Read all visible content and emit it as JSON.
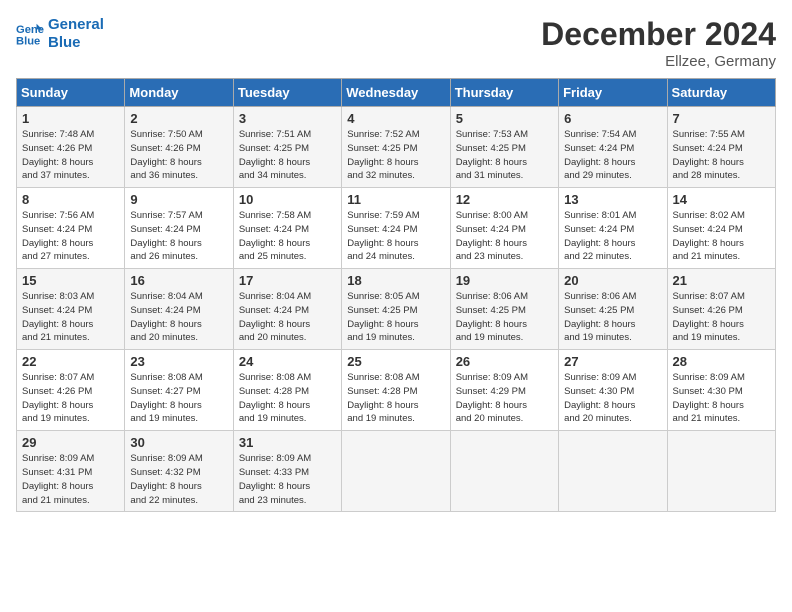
{
  "logo": {
    "line1": "General",
    "line2": "Blue"
  },
  "title": "December 2024",
  "subtitle": "Ellzee, Germany",
  "header_days": [
    "Sunday",
    "Monday",
    "Tuesday",
    "Wednesday",
    "Thursday",
    "Friday",
    "Saturday"
  ],
  "weeks": [
    [
      {
        "day": "1",
        "sunrise": "7:48 AM",
        "sunset": "4:26 PM",
        "daylight": "8 hours and 37 minutes."
      },
      {
        "day": "2",
        "sunrise": "7:50 AM",
        "sunset": "4:26 PM",
        "daylight": "8 hours and 36 minutes."
      },
      {
        "day": "3",
        "sunrise": "7:51 AM",
        "sunset": "4:25 PM",
        "daylight": "8 hours and 34 minutes."
      },
      {
        "day": "4",
        "sunrise": "7:52 AM",
        "sunset": "4:25 PM",
        "daylight": "8 hours and 32 minutes."
      },
      {
        "day": "5",
        "sunrise": "7:53 AM",
        "sunset": "4:25 PM",
        "daylight": "8 hours and 31 minutes."
      },
      {
        "day": "6",
        "sunrise": "7:54 AM",
        "sunset": "4:24 PM",
        "daylight": "8 hours and 29 minutes."
      },
      {
        "day": "7",
        "sunrise": "7:55 AM",
        "sunset": "4:24 PM",
        "daylight": "8 hours and 28 minutes."
      }
    ],
    [
      {
        "day": "8",
        "sunrise": "7:56 AM",
        "sunset": "4:24 PM",
        "daylight": "8 hours and 27 minutes."
      },
      {
        "day": "9",
        "sunrise": "7:57 AM",
        "sunset": "4:24 PM",
        "daylight": "8 hours and 26 minutes."
      },
      {
        "day": "10",
        "sunrise": "7:58 AM",
        "sunset": "4:24 PM",
        "daylight": "8 hours and 25 minutes."
      },
      {
        "day": "11",
        "sunrise": "7:59 AM",
        "sunset": "4:24 PM",
        "daylight": "8 hours and 24 minutes."
      },
      {
        "day": "12",
        "sunrise": "8:00 AM",
        "sunset": "4:24 PM",
        "daylight": "8 hours and 23 minutes."
      },
      {
        "day": "13",
        "sunrise": "8:01 AM",
        "sunset": "4:24 PM",
        "daylight": "8 hours and 22 minutes."
      },
      {
        "day": "14",
        "sunrise": "8:02 AM",
        "sunset": "4:24 PM",
        "daylight": "8 hours and 21 minutes."
      }
    ],
    [
      {
        "day": "15",
        "sunrise": "8:03 AM",
        "sunset": "4:24 PM",
        "daylight": "8 hours and 21 minutes."
      },
      {
        "day": "16",
        "sunrise": "8:04 AM",
        "sunset": "4:24 PM",
        "daylight": "8 hours and 20 minutes."
      },
      {
        "day": "17",
        "sunrise": "8:04 AM",
        "sunset": "4:24 PM",
        "daylight": "8 hours and 20 minutes."
      },
      {
        "day": "18",
        "sunrise": "8:05 AM",
        "sunset": "4:25 PM",
        "daylight": "8 hours and 19 minutes."
      },
      {
        "day": "19",
        "sunrise": "8:06 AM",
        "sunset": "4:25 PM",
        "daylight": "8 hours and 19 minutes."
      },
      {
        "day": "20",
        "sunrise": "8:06 AM",
        "sunset": "4:25 PM",
        "daylight": "8 hours and 19 minutes."
      },
      {
        "day": "21",
        "sunrise": "8:07 AM",
        "sunset": "4:26 PM",
        "daylight": "8 hours and 19 minutes."
      }
    ],
    [
      {
        "day": "22",
        "sunrise": "8:07 AM",
        "sunset": "4:26 PM",
        "daylight": "8 hours and 19 minutes."
      },
      {
        "day": "23",
        "sunrise": "8:08 AM",
        "sunset": "4:27 PM",
        "daylight": "8 hours and 19 minutes."
      },
      {
        "day": "24",
        "sunrise": "8:08 AM",
        "sunset": "4:28 PM",
        "daylight": "8 hours and 19 minutes."
      },
      {
        "day": "25",
        "sunrise": "8:08 AM",
        "sunset": "4:28 PM",
        "daylight": "8 hours and 19 minutes."
      },
      {
        "day": "26",
        "sunrise": "8:09 AM",
        "sunset": "4:29 PM",
        "daylight": "8 hours and 20 minutes."
      },
      {
        "day": "27",
        "sunrise": "8:09 AM",
        "sunset": "4:30 PM",
        "daylight": "8 hours and 20 minutes."
      },
      {
        "day": "28",
        "sunrise": "8:09 AM",
        "sunset": "4:30 PM",
        "daylight": "8 hours and 21 minutes."
      }
    ],
    [
      {
        "day": "29",
        "sunrise": "8:09 AM",
        "sunset": "4:31 PM",
        "daylight": "8 hours and 21 minutes."
      },
      {
        "day": "30",
        "sunrise": "8:09 AM",
        "sunset": "4:32 PM",
        "daylight": "8 hours and 22 minutes."
      },
      {
        "day": "31",
        "sunrise": "8:09 AM",
        "sunset": "4:33 PM",
        "daylight": "8 hours and 23 minutes."
      },
      null,
      null,
      null,
      null
    ]
  ]
}
